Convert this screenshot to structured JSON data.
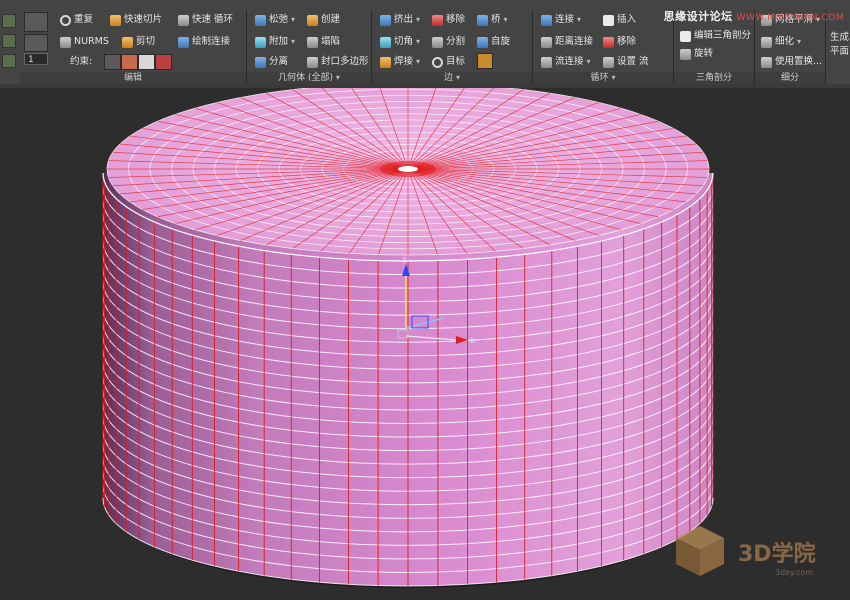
{
  "watermark_top": {
    "text": "思缘设计论坛",
    "site": "WWW.MISSYUAN.COM"
  },
  "ribbon": {
    "groups": [
      {
        "id": "edit",
        "caption": "编辑"
      },
      {
        "id": "geometry",
        "caption": "几何体 (全部)"
      },
      {
        "id": "edges",
        "caption": "边"
      },
      {
        "id": "loops",
        "caption": "循环"
      },
      {
        "id": "tris",
        "caption": "三角剖分"
      },
      {
        "id": "subdiv",
        "caption": "细分"
      }
    ],
    "edit": {
      "repeat": "重复",
      "quickslice": "快速切片",
      "quickloop": "快速 循环",
      "nurms": "NURMS",
      "cut": "剪切",
      "paintconnect": "绘制连接",
      "constraints": "约束:",
      "spin_value": "1"
    },
    "geometry": {
      "relax": "松弛",
      "create": "创建",
      "attach": "附加",
      "collapse": "塌陷",
      "detach": "分离",
      "cap": "封口多边形"
    },
    "edges": {
      "extrude": "挤出",
      "remove": "移除",
      "bridge": "桥",
      "chamfer": "切角",
      "split": "分割",
      "spin": "自旋",
      "weld": "焊接",
      "target": "目标"
    },
    "loops": {
      "connect": "连接",
      "insert": "插入",
      "distconnect": "距离连接",
      "remove": "移除",
      "flowconnect": "流连接",
      "setflow": "设置 流"
    },
    "tris": {
      "edittri": "编辑三角剖分",
      "turn": "旋转"
    },
    "subdiv": {
      "meshsmooth": "网格平滑",
      "tessellate": "细化",
      "usedisp": "使用置换..."
    },
    "extra": {
      "line1": "生成",
      "line2": "平面"
    }
  },
  "logo": {
    "text": "3D学院",
    "sub": "3dxy.com"
  },
  "gizmo": {
    "axis_z": "z",
    "axis_x": "x"
  },
  "colors": {
    "mesh_side": "#d98ad0",
    "mesh_top": "#e7a7dc",
    "wire_white": "#ffffff",
    "wire_red": "#e01818",
    "ribbon": "#444444",
    "viewport_bg": "#2d2d2d"
  }
}
